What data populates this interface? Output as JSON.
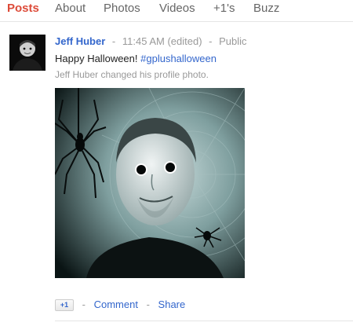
{
  "tabs": [
    {
      "label": "Posts",
      "active": true
    },
    {
      "label": "About"
    },
    {
      "label": "Photos"
    },
    {
      "label": "Videos"
    },
    {
      "label": "+1's"
    },
    {
      "label": "Buzz"
    }
  ],
  "post": {
    "author": "Jeff Huber",
    "time": "11:45 AM (edited)",
    "sep": "-",
    "visibility": "Public",
    "text": "Happy Halloween!",
    "hashtag": "#gplushalloween",
    "subtext": "Jeff Huber changed his profile photo."
  },
  "actions": {
    "plusone_label": "+1",
    "sep": "-",
    "comment": "Comment",
    "share": "Share"
  },
  "colors": {
    "accent": "#dd4b39",
    "link": "#3366cc",
    "muted": "#999999"
  }
}
